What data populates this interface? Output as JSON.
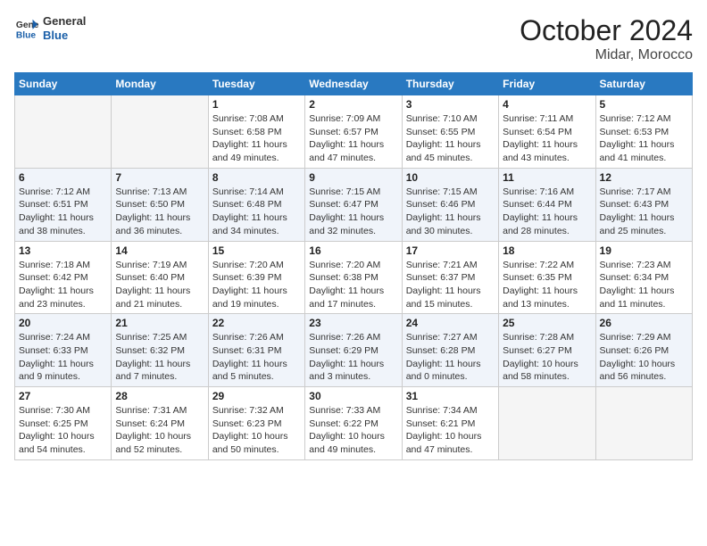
{
  "logo": {
    "text_general": "General",
    "text_blue": "Blue"
  },
  "header": {
    "month": "October 2024",
    "location": "Midar, Morocco"
  },
  "weekdays": [
    "Sunday",
    "Monday",
    "Tuesday",
    "Wednesday",
    "Thursday",
    "Friday",
    "Saturday"
  ],
  "weeks": [
    [
      {
        "day": "",
        "empty": true
      },
      {
        "day": "",
        "empty": true
      },
      {
        "day": "1",
        "sunrise": "7:08 AM",
        "sunset": "6:58 PM",
        "daylight": "11 hours and 49 minutes."
      },
      {
        "day": "2",
        "sunrise": "7:09 AM",
        "sunset": "6:57 PM",
        "daylight": "11 hours and 47 minutes."
      },
      {
        "day": "3",
        "sunrise": "7:10 AM",
        "sunset": "6:55 PM",
        "daylight": "11 hours and 45 minutes."
      },
      {
        "day": "4",
        "sunrise": "7:11 AM",
        "sunset": "6:54 PM",
        "daylight": "11 hours and 43 minutes."
      },
      {
        "day": "5",
        "sunrise": "7:12 AM",
        "sunset": "6:53 PM",
        "daylight": "11 hours and 41 minutes."
      }
    ],
    [
      {
        "day": "6",
        "sunrise": "7:12 AM",
        "sunset": "6:51 PM",
        "daylight": "11 hours and 38 minutes."
      },
      {
        "day": "7",
        "sunrise": "7:13 AM",
        "sunset": "6:50 PM",
        "daylight": "11 hours and 36 minutes."
      },
      {
        "day": "8",
        "sunrise": "7:14 AM",
        "sunset": "6:48 PM",
        "daylight": "11 hours and 34 minutes."
      },
      {
        "day": "9",
        "sunrise": "7:15 AM",
        "sunset": "6:47 PM",
        "daylight": "11 hours and 32 minutes."
      },
      {
        "day": "10",
        "sunrise": "7:15 AM",
        "sunset": "6:46 PM",
        "daylight": "11 hours and 30 minutes."
      },
      {
        "day": "11",
        "sunrise": "7:16 AM",
        "sunset": "6:44 PM",
        "daylight": "11 hours and 28 minutes."
      },
      {
        "day": "12",
        "sunrise": "7:17 AM",
        "sunset": "6:43 PM",
        "daylight": "11 hours and 25 minutes."
      }
    ],
    [
      {
        "day": "13",
        "sunrise": "7:18 AM",
        "sunset": "6:42 PM",
        "daylight": "11 hours and 23 minutes."
      },
      {
        "day": "14",
        "sunrise": "7:19 AM",
        "sunset": "6:40 PM",
        "daylight": "11 hours and 21 minutes."
      },
      {
        "day": "15",
        "sunrise": "7:20 AM",
        "sunset": "6:39 PM",
        "daylight": "11 hours and 19 minutes."
      },
      {
        "day": "16",
        "sunrise": "7:20 AM",
        "sunset": "6:38 PM",
        "daylight": "11 hours and 17 minutes."
      },
      {
        "day": "17",
        "sunrise": "7:21 AM",
        "sunset": "6:37 PM",
        "daylight": "11 hours and 15 minutes."
      },
      {
        "day": "18",
        "sunrise": "7:22 AM",
        "sunset": "6:35 PM",
        "daylight": "11 hours and 13 minutes."
      },
      {
        "day": "19",
        "sunrise": "7:23 AM",
        "sunset": "6:34 PM",
        "daylight": "11 hours and 11 minutes."
      }
    ],
    [
      {
        "day": "20",
        "sunrise": "7:24 AM",
        "sunset": "6:33 PM",
        "daylight": "11 hours and 9 minutes."
      },
      {
        "day": "21",
        "sunrise": "7:25 AM",
        "sunset": "6:32 PM",
        "daylight": "11 hours and 7 minutes."
      },
      {
        "day": "22",
        "sunrise": "7:26 AM",
        "sunset": "6:31 PM",
        "daylight": "11 hours and 5 minutes."
      },
      {
        "day": "23",
        "sunrise": "7:26 AM",
        "sunset": "6:29 PM",
        "daylight": "11 hours and 3 minutes."
      },
      {
        "day": "24",
        "sunrise": "7:27 AM",
        "sunset": "6:28 PM",
        "daylight": "11 hours and 0 minutes."
      },
      {
        "day": "25",
        "sunrise": "7:28 AM",
        "sunset": "6:27 PM",
        "daylight": "10 hours and 58 minutes."
      },
      {
        "day": "26",
        "sunrise": "7:29 AM",
        "sunset": "6:26 PM",
        "daylight": "10 hours and 56 minutes."
      }
    ],
    [
      {
        "day": "27",
        "sunrise": "7:30 AM",
        "sunset": "6:25 PM",
        "daylight": "10 hours and 54 minutes."
      },
      {
        "day": "28",
        "sunrise": "7:31 AM",
        "sunset": "6:24 PM",
        "daylight": "10 hours and 52 minutes."
      },
      {
        "day": "29",
        "sunrise": "7:32 AM",
        "sunset": "6:23 PM",
        "daylight": "10 hours and 50 minutes."
      },
      {
        "day": "30",
        "sunrise": "7:33 AM",
        "sunset": "6:22 PM",
        "daylight": "10 hours and 49 minutes."
      },
      {
        "day": "31",
        "sunrise": "7:34 AM",
        "sunset": "6:21 PM",
        "daylight": "10 hours and 47 minutes."
      },
      {
        "day": "",
        "empty": true
      },
      {
        "day": "",
        "empty": true
      }
    ]
  ]
}
